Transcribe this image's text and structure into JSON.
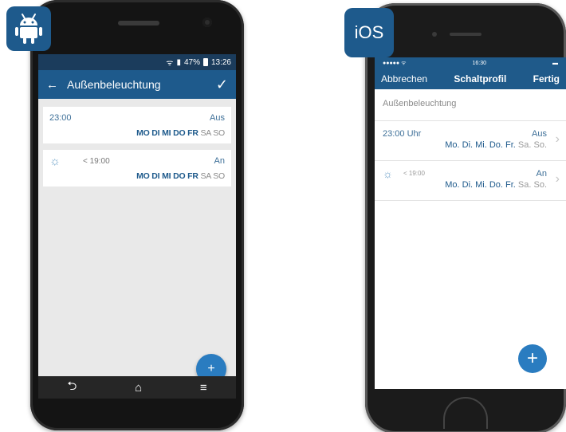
{
  "android": {
    "status_bar": {
      "battery": "47%",
      "time": "13:26"
    },
    "app_bar": {
      "title": "Außenbeleuchtung",
      "back_icon": "arrow-left-icon",
      "confirm_icon": "check-icon"
    },
    "rows": [
      {
        "time": "23:00",
        "state": "Aus",
        "days_active": "MO DI MI DO FR",
        "days_inactive": "SA SO"
      },
      {
        "icon": "sunset-icon",
        "time": "< 19:00",
        "state": "An",
        "days_active": "MO DI MI DO FR",
        "days_inactive": "SA SO"
      }
    ],
    "fab_label": "+",
    "nav": {
      "back": "⮌",
      "home": "⌂",
      "menu": "≡"
    }
  },
  "ios": {
    "badge": "iOS",
    "status_bar": {
      "carrier": "●●●●● ᯤ",
      "time": "16:30"
    },
    "nav_bar": {
      "cancel": "Abbrechen",
      "title": "Schaltprofil",
      "done": "Fertig"
    },
    "profile_name": "Außenbeleuchtung",
    "rows": [
      {
        "time": "23:00 Uhr",
        "state": "Aus",
        "days_active": "Mo. Di. Mi. Do. Fr.",
        "days_inactive": "Sa. So."
      },
      {
        "icon": "sunset-icon",
        "time": "< 19:00",
        "state": "An",
        "days_active": "Mo. Di. Mi. Do. Fr.",
        "days_inactive": "Sa. So."
      }
    ],
    "fab_label": "+"
  },
  "colors": {
    "primary": "#1e5a8c",
    "fab": "#2a7cc0",
    "status_dark": "#1b3c5c"
  }
}
